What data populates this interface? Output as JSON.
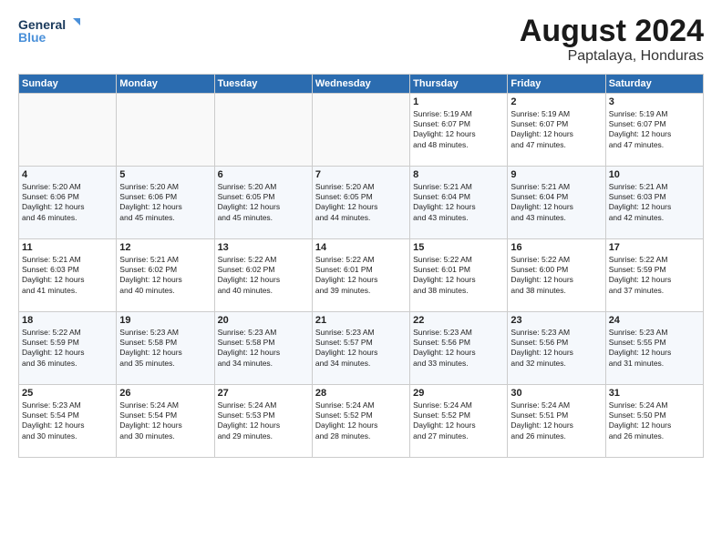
{
  "logo": {
    "line1": "General",
    "line2": "Blue"
  },
  "title": "August 2024",
  "location": "Paptalaya, Honduras",
  "days_header": [
    "Sunday",
    "Monday",
    "Tuesday",
    "Wednesday",
    "Thursday",
    "Friday",
    "Saturday"
  ],
  "weeks": [
    [
      {
        "day": "",
        "text": ""
      },
      {
        "day": "",
        "text": ""
      },
      {
        "day": "",
        "text": ""
      },
      {
        "day": "",
        "text": ""
      },
      {
        "day": "1",
        "text": "Sunrise: 5:19 AM\nSunset: 6:07 PM\nDaylight: 12 hours\nand 48 minutes."
      },
      {
        "day": "2",
        "text": "Sunrise: 5:19 AM\nSunset: 6:07 PM\nDaylight: 12 hours\nand 47 minutes."
      },
      {
        "day": "3",
        "text": "Sunrise: 5:19 AM\nSunset: 6:07 PM\nDaylight: 12 hours\nand 47 minutes."
      }
    ],
    [
      {
        "day": "4",
        "text": "Sunrise: 5:20 AM\nSunset: 6:06 PM\nDaylight: 12 hours\nand 46 minutes."
      },
      {
        "day": "5",
        "text": "Sunrise: 5:20 AM\nSunset: 6:06 PM\nDaylight: 12 hours\nand 45 minutes."
      },
      {
        "day": "6",
        "text": "Sunrise: 5:20 AM\nSunset: 6:05 PM\nDaylight: 12 hours\nand 45 minutes."
      },
      {
        "day": "7",
        "text": "Sunrise: 5:20 AM\nSunset: 6:05 PM\nDaylight: 12 hours\nand 44 minutes."
      },
      {
        "day": "8",
        "text": "Sunrise: 5:21 AM\nSunset: 6:04 PM\nDaylight: 12 hours\nand 43 minutes."
      },
      {
        "day": "9",
        "text": "Sunrise: 5:21 AM\nSunset: 6:04 PM\nDaylight: 12 hours\nand 43 minutes."
      },
      {
        "day": "10",
        "text": "Sunrise: 5:21 AM\nSunset: 6:03 PM\nDaylight: 12 hours\nand 42 minutes."
      }
    ],
    [
      {
        "day": "11",
        "text": "Sunrise: 5:21 AM\nSunset: 6:03 PM\nDaylight: 12 hours\nand 41 minutes."
      },
      {
        "day": "12",
        "text": "Sunrise: 5:21 AM\nSunset: 6:02 PM\nDaylight: 12 hours\nand 40 minutes."
      },
      {
        "day": "13",
        "text": "Sunrise: 5:22 AM\nSunset: 6:02 PM\nDaylight: 12 hours\nand 40 minutes."
      },
      {
        "day": "14",
        "text": "Sunrise: 5:22 AM\nSunset: 6:01 PM\nDaylight: 12 hours\nand 39 minutes."
      },
      {
        "day": "15",
        "text": "Sunrise: 5:22 AM\nSunset: 6:01 PM\nDaylight: 12 hours\nand 38 minutes."
      },
      {
        "day": "16",
        "text": "Sunrise: 5:22 AM\nSunset: 6:00 PM\nDaylight: 12 hours\nand 38 minutes."
      },
      {
        "day": "17",
        "text": "Sunrise: 5:22 AM\nSunset: 5:59 PM\nDaylight: 12 hours\nand 37 minutes."
      }
    ],
    [
      {
        "day": "18",
        "text": "Sunrise: 5:22 AM\nSunset: 5:59 PM\nDaylight: 12 hours\nand 36 minutes."
      },
      {
        "day": "19",
        "text": "Sunrise: 5:23 AM\nSunset: 5:58 PM\nDaylight: 12 hours\nand 35 minutes."
      },
      {
        "day": "20",
        "text": "Sunrise: 5:23 AM\nSunset: 5:58 PM\nDaylight: 12 hours\nand 34 minutes."
      },
      {
        "day": "21",
        "text": "Sunrise: 5:23 AM\nSunset: 5:57 PM\nDaylight: 12 hours\nand 34 minutes."
      },
      {
        "day": "22",
        "text": "Sunrise: 5:23 AM\nSunset: 5:56 PM\nDaylight: 12 hours\nand 33 minutes."
      },
      {
        "day": "23",
        "text": "Sunrise: 5:23 AM\nSunset: 5:56 PM\nDaylight: 12 hours\nand 32 minutes."
      },
      {
        "day": "24",
        "text": "Sunrise: 5:23 AM\nSunset: 5:55 PM\nDaylight: 12 hours\nand 31 minutes."
      }
    ],
    [
      {
        "day": "25",
        "text": "Sunrise: 5:23 AM\nSunset: 5:54 PM\nDaylight: 12 hours\nand 30 minutes."
      },
      {
        "day": "26",
        "text": "Sunrise: 5:24 AM\nSunset: 5:54 PM\nDaylight: 12 hours\nand 30 minutes."
      },
      {
        "day": "27",
        "text": "Sunrise: 5:24 AM\nSunset: 5:53 PM\nDaylight: 12 hours\nand 29 minutes."
      },
      {
        "day": "28",
        "text": "Sunrise: 5:24 AM\nSunset: 5:52 PM\nDaylight: 12 hours\nand 28 minutes."
      },
      {
        "day": "29",
        "text": "Sunrise: 5:24 AM\nSunset: 5:52 PM\nDaylight: 12 hours\nand 27 minutes."
      },
      {
        "day": "30",
        "text": "Sunrise: 5:24 AM\nSunset: 5:51 PM\nDaylight: 12 hours\nand 26 minutes."
      },
      {
        "day": "31",
        "text": "Sunrise: 5:24 AM\nSunset: 5:50 PM\nDaylight: 12 hours\nand 26 minutes."
      }
    ]
  ]
}
